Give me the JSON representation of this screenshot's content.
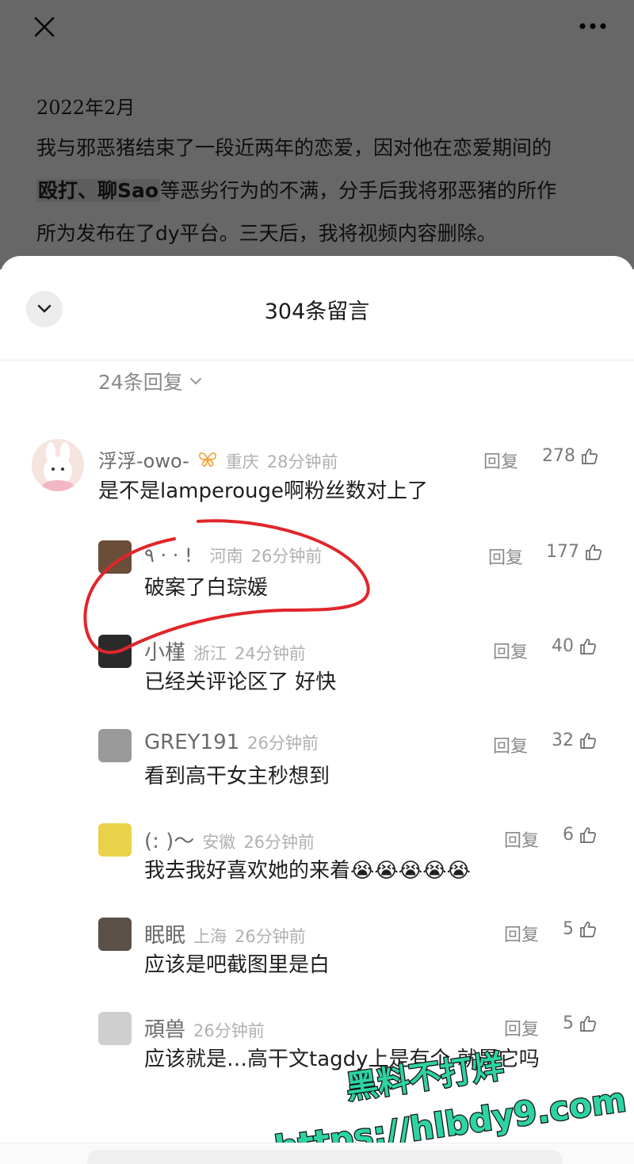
{
  "article": {
    "date": "2022年2月",
    "line1": "我与邪恶猪结束了一段近两年的恋爱，因对他在恋爱期间的",
    "highlight": "殴打、聊Sao",
    "line2_rest": "等恶劣行为的不满，分手后我将邪恶猪的所作",
    "line3": "所为发布在了dy平台。三天后，我将视频内容删除。"
  },
  "sheet": {
    "title": "304条留言",
    "replies_toggle": "24条回复"
  },
  "reply_label": "回复",
  "comments": [
    {
      "name": "浮浮-owo-",
      "location": "重庆",
      "time": "28分钟前",
      "text": "是不是lamperouge啊粉丝数对上了",
      "likes": "278"
    },
    {
      "name": "٩ · · !",
      "location": "河南",
      "time": "26分钟前",
      "text": "破案了白琮媛",
      "likes": "177"
    },
    {
      "name": "小槿",
      "location": "浙江",
      "time": "24分钟前",
      "text": "已经关评论区了 好快",
      "likes": "40"
    },
    {
      "name": "GREY191",
      "location": "",
      "time": "26分钟前",
      "text": "看到高干女主秒想到",
      "likes": "32"
    },
    {
      "name": "(: )～",
      "location": "安徽",
      "time": "26分钟前",
      "text": "我去我好喜欢她的来着😭😭😭😭😭",
      "likes": "6"
    },
    {
      "name": "眠眠",
      "location": "上海",
      "time": "26分钟前",
      "text": "应该是吧截图里是白",
      "likes": "5"
    },
    {
      "name": "頑兽",
      "location": "",
      "time": "26分钟前",
      "text": "应该就是…高干文tagdy上是有个 就是它吗",
      "likes": "5"
    }
  ],
  "watermark": {
    "line1": "黑料不打烊",
    "line2": "https://hlbdy9.com"
  },
  "colors": {
    "annotation": "#e0262a",
    "watermark_fill": "#2ed3a3",
    "watermark_stroke": "#111111",
    "vip_icon": "#f0a030"
  },
  "icons": [
    "close-icon",
    "more-icon",
    "chevron-down-icon",
    "thumb-up-icon",
    "butterfly-icon"
  ]
}
